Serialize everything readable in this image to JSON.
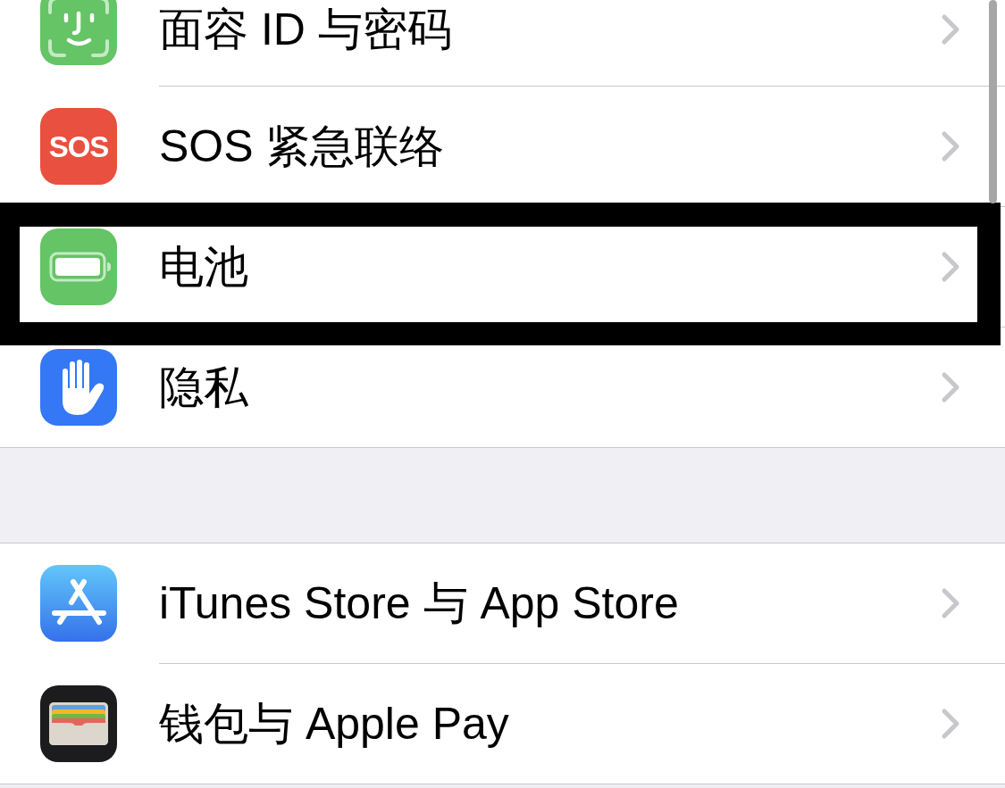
{
  "sections": [
    {
      "rows": [
        {
          "kind": "faceid",
          "label": "面容 ID 与密码",
          "highlighted": false
        },
        {
          "kind": "sos",
          "label": "SOS 紧急联络",
          "icon_text": "SOS",
          "highlighted": false
        },
        {
          "kind": "battery",
          "label": "电池",
          "highlighted": true
        },
        {
          "kind": "privacy",
          "label": "隐私",
          "highlighted": false
        }
      ]
    },
    {
      "rows": [
        {
          "kind": "appstore",
          "label": "iTunes Store 与 App Store",
          "highlighted": false
        },
        {
          "kind": "wallet",
          "label": "钱包与 Apple Pay",
          "highlighted": false
        }
      ]
    }
  ]
}
